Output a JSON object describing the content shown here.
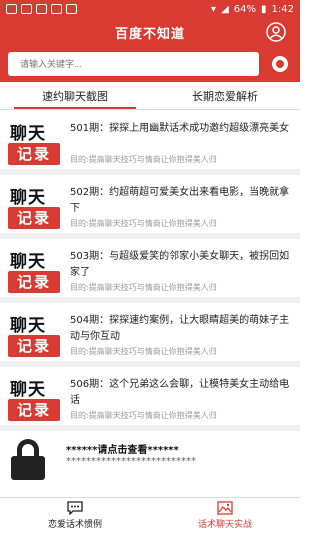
{
  "status_bar": {
    "battery": "64%",
    "time": "1:42"
  },
  "app": {
    "title": "百度不知道"
  },
  "search": {
    "placeholder": "请输入关键字..."
  },
  "tabs": [
    {
      "label": "速约聊天截图",
      "active": true
    },
    {
      "label": "长期恋爱解析",
      "active": false
    }
  ],
  "thumb_text": {
    "top": "聊天",
    "bottom": "记录"
  },
  "articles": [
    {
      "title": "501期：探探上用幽默话术成功邀约超级漂亮美女",
      "subtitle": "目的:提高聊天技巧与情商让你抱得美人归"
    },
    {
      "title": "502期：约超萌超可爱美女出来看电影，当晚就拿下",
      "subtitle": "目的:提高聊天技巧与情商让你抱得美人归"
    },
    {
      "title": "503期：与超级爱笑的邻家小美女聊天，被拐回如家了",
      "subtitle": "目的:提高聊天技巧与情商让你抱得美人归"
    },
    {
      "title": "504期：探探速约案例，让大眼睛超美的萌妹子主动与你互动",
      "subtitle": "目的:提高聊天技巧与情商让你抱得美人归"
    },
    {
      "title": "506期：这个兄弟这么会聊，让模特美女主动给电话",
      "subtitle": "目的:提高聊天技巧与情商让你抱得美人归"
    }
  ],
  "locked": {
    "message": "******请点击查看******",
    "stars": "**************************"
  },
  "bottom_nav": [
    {
      "label": "恋爱话术惯例",
      "icon": "chat-bubble-icon",
      "active": false
    },
    {
      "label": "话术聊天实战",
      "icon": "image-icon",
      "active": true
    }
  ],
  "colors": {
    "accent": "#d93a32"
  }
}
